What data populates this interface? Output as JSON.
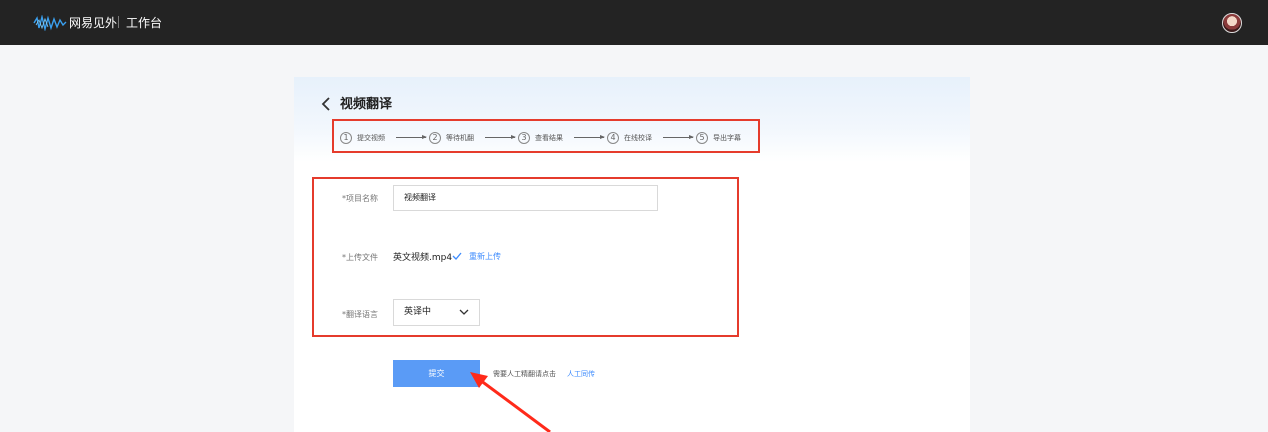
{
  "topbar": {
    "brand": "网易见外",
    "workspace": "工作台",
    "logo_icon": "wave-logo-icon",
    "avatar_icon": "user-avatar"
  },
  "page": {
    "title": "视频翻译",
    "back_icon": "chevron-left-icon"
  },
  "steps": [
    {
      "num": "1",
      "label": "提交视频"
    },
    {
      "num": "2",
      "label": "等待机翻"
    },
    {
      "num": "3",
      "label": "查看结果"
    },
    {
      "num": "4",
      "label": "在线校译"
    },
    {
      "num": "5",
      "label": "导出字幕"
    }
  ],
  "form": {
    "project_name_label": "*项目名称",
    "project_name_value": "视频翻译",
    "upload_label": "*上传文件",
    "file_name": "英文视频.mp4",
    "reupload": "重新上传",
    "language_label": "*翻译语言",
    "language_value": "英译中"
  },
  "actions": {
    "submit": "提交",
    "hint": "需要人工精翻请点击",
    "manual_link": "人工同传"
  },
  "colors": {
    "accent": "#5a9bf6",
    "link": "#3d8bfd",
    "highlight": "#e53b2c",
    "topbar": "#232323"
  }
}
